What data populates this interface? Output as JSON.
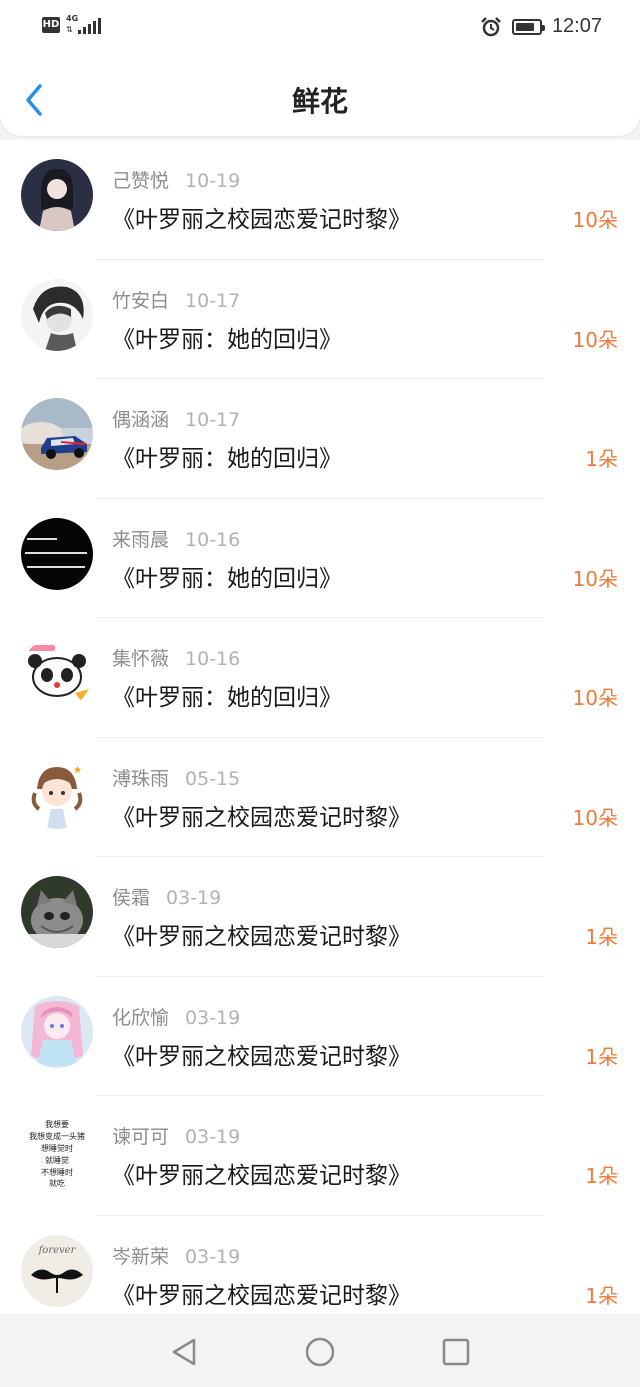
{
  "status_bar": {
    "hd": "HD",
    "network": "4G",
    "time": "12:07",
    "icons": [
      "hd-icon",
      "signal-icon",
      "alarm-icon",
      "battery-icon"
    ]
  },
  "header": {
    "title": "鲜花",
    "back_icon": "chevron-left-icon"
  },
  "accent_color": "#f07a3a",
  "items": [
    {
      "name": "己赞悦",
      "date": "10-19",
      "book": "《叶罗丽之校园恋爱记时黎》",
      "count": "10朵"
    },
    {
      "name": "竹安白",
      "date": "10-17",
      "book": "《叶罗丽：她的回归》",
      "count": "10朵"
    },
    {
      "name": "偶涵涵",
      "date": "10-17",
      "book": "《叶罗丽：她的回归》",
      "count": "1朵"
    },
    {
      "name": "来雨晨",
      "date": "10-16",
      "book": "《叶罗丽：她的回归》",
      "count": "10朵"
    },
    {
      "name": "集怀薇",
      "date": "10-16",
      "book": "《叶罗丽：她的回归》",
      "count": "10朵"
    },
    {
      "name": "溥珠雨",
      "date": "05-15",
      "book": "《叶罗丽之校园恋爱记时黎》",
      "count": "10朵"
    },
    {
      "name": "侯霜",
      "date": "03-19",
      "book": "《叶罗丽之校园恋爱记时黎》",
      "count": "1朵"
    },
    {
      "name": "化欣愉",
      "date": "03-19",
      "book": "《叶罗丽之校园恋爱记时黎》",
      "count": "1朵"
    },
    {
      "name": "谏可可",
      "date": "03-19",
      "book": "《叶罗丽之校园恋爱记时黎》",
      "count": "1朵"
    },
    {
      "name": "岑新荣",
      "date": "03-19",
      "book": "《叶罗丽之校园恋爱记时黎》",
      "count": "1朵"
    }
  ],
  "avatar_texts": {
    "rain": [
      "我想要",
      "我想变成一头猪",
      "想睡觉时",
      "就睡觉",
      "不想睡时",
      "就吃"
    ],
    "forever": "forever"
  },
  "nav": {
    "back_icon": "triangle-back-icon",
    "home_icon": "circle-home-icon",
    "recent_icon": "square-recent-icon"
  }
}
